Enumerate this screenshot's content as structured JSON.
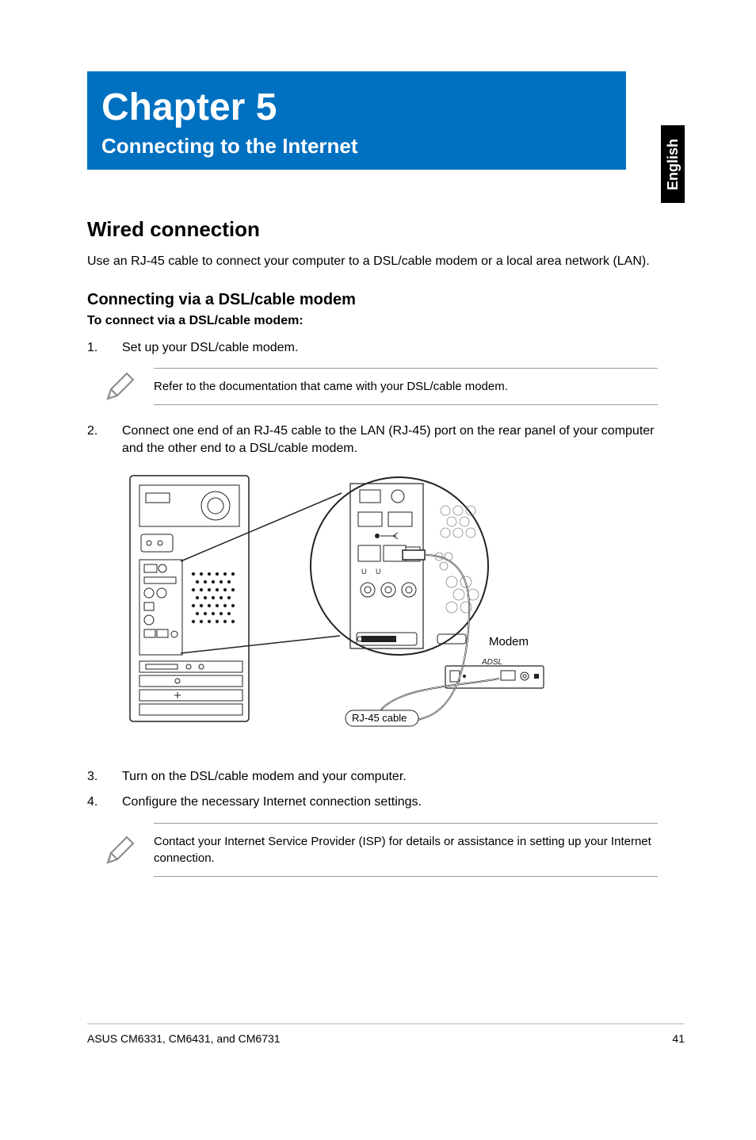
{
  "language_tab": "English",
  "chapter": {
    "number": "Chapter 5",
    "title": "Connecting to the Internet"
  },
  "section": {
    "heading": "Wired connection",
    "intro": "Use an RJ-45 cable to connect your computer to a DSL/cable modem or a local area network (LAN)."
  },
  "subsection": {
    "heading": "Connecting via a DSL/cable modem",
    "lead": "To connect via a DSL/cable modem:"
  },
  "steps": [
    {
      "n": "1.",
      "text": "Set up your DSL/cable modem."
    },
    {
      "n": "2.",
      "text": "Connect one end of an RJ-45 cable to the LAN (RJ-45) port on the rear panel of your computer and the other end to a DSL/cable modem."
    },
    {
      "n": "3.",
      "text": "Turn on the DSL/cable modem and your computer."
    },
    {
      "n": "4.",
      "text": "Configure the necessary Internet connection settings."
    }
  ],
  "notes": [
    "Refer to the documentation that came with your DSL/cable modem.",
    "Contact your Internet Service Provider (ISP) for details or assistance in setting up your Internet connection."
  ],
  "diagram_labels": {
    "modem": "Modem",
    "cable": "RJ-45 cable"
  },
  "footer": {
    "product": "ASUS CM6331, CM6431, and CM6731",
    "page": "41"
  }
}
